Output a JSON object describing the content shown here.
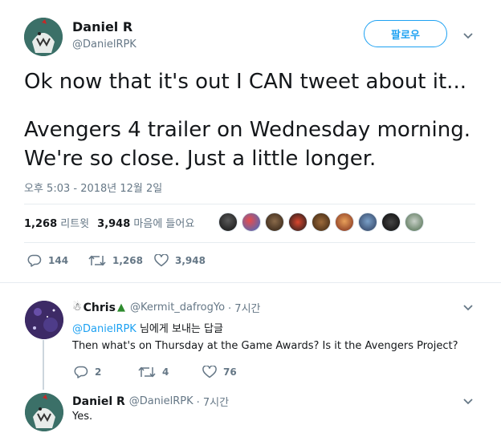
{
  "tweet": {
    "author_name": "Daniel R",
    "author_handle": "@DanielRPK",
    "follow_label": "팔로우",
    "text_line1": "Ok now that it's out I CAN tweet about it...",
    "text_line2": "Avengers 4 trailer on Wednesday morning.",
    "text_line3": "We're so close. Just a little longer.",
    "timestamp": "오후 5:03 - 2018년 12월 2일",
    "retweets_count": "1,268",
    "retweets_label": "리트윗",
    "likes_count": "3,948",
    "likes_label": "마음에 들어요",
    "actions": {
      "reply_count": "144",
      "retweet_count": "1,268",
      "like_count": "3,948"
    }
  },
  "replies": [
    {
      "author_name": "Chris",
      "author_handle": "@Kermit_dafrogYo",
      "time": "· 7시간",
      "replying_to_handle": "@DanielRPK",
      "replying_to_suffix": " 님에게 보내는 답글",
      "text": "Then what's on Thursday at the Game Awards? Is it the Avengers Project?",
      "reply_count": "2",
      "retweet_count": "4",
      "like_count": "76"
    },
    {
      "author_name": "Daniel R",
      "author_handle": "@DanielRPK",
      "time": "· 7시간",
      "text": "Yes."
    }
  ],
  "colors": {
    "accent": "#1da1f2",
    "secondary_text": "#657786",
    "divider": "#e6ecf0"
  }
}
